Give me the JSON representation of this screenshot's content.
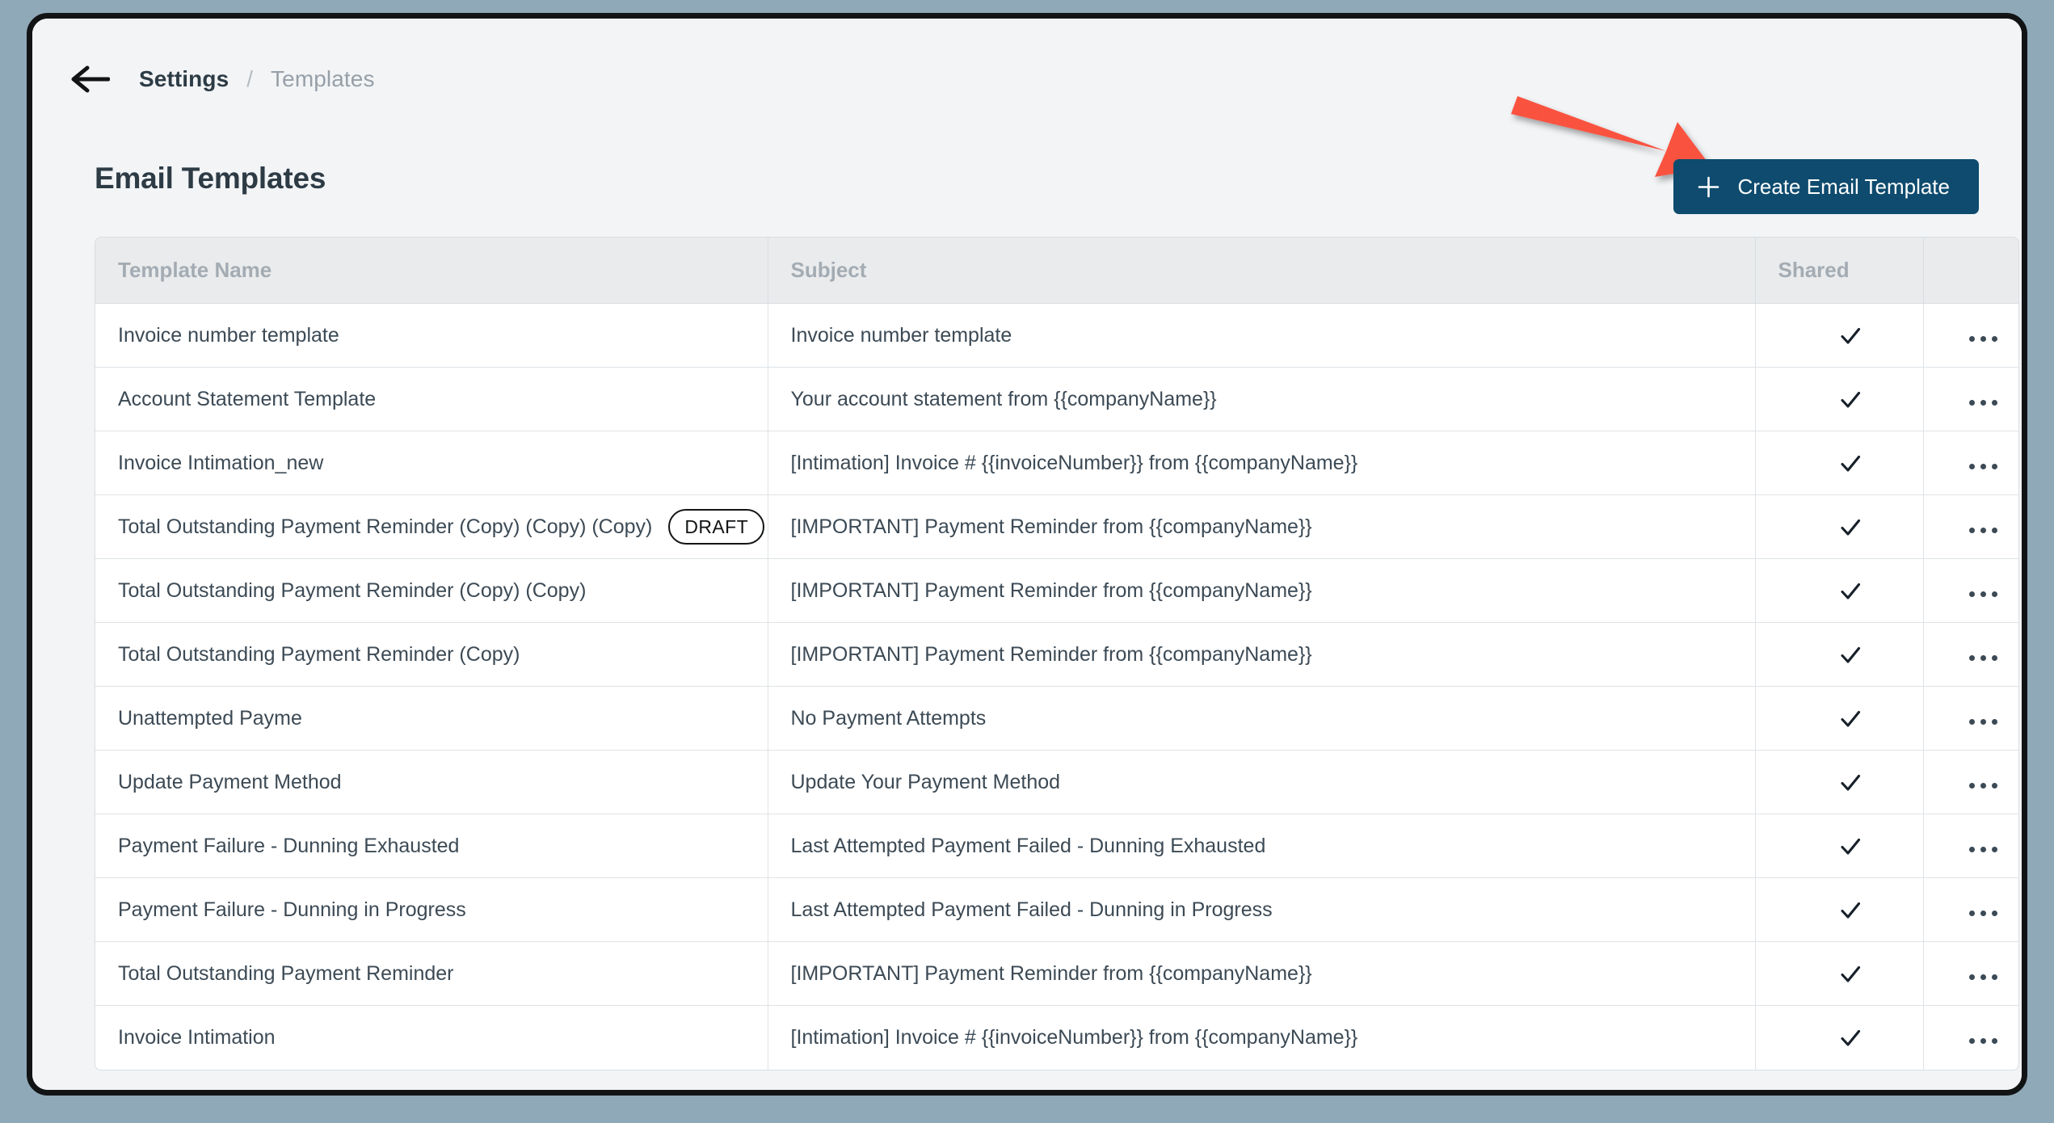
{
  "window": {
    "backdrop_color": "#8fa9b8",
    "frame_color": "#111315",
    "page_background": "#f2f4f6"
  },
  "breadcrumb": {
    "back_icon": "arrow-left-icon",
    "parent": "Settings",
    "separator": "/",
    "current": "Templates"
  },
  "header": {
    "title": "Email Templates",
    "create_button": {
      "label": "Create Email Template",
      "icon": "plus-icon",
      "background_color": "#0e4b6e",
      "text_color": "#ffffff"
    }
  },
  "annotation": {
    "type": "arrow",
    "color": "#f9523f",
    "points_to": "create-email-template-button"
  },
  "table": {
    "columns": [
      {
        "key": "name",
        "label": "Template Name"
      },
      {
        "key": "subject",
        "label": "Subject"
      },
      {
        "key": "shared",
        "label": "Shared"
      },
      {
        "key": "actions",
        "label": ""
      }
    ],
    "shared_icon": "check-icon",
    "actions_icon": "ellipsis-icon",
    "rows": [
      {
        "name": "Invoice number template",
        "badge": "",
        "subject": "Invoice number template",
        "shared": true
      },
      {
        "name": "Account Statement Template",
        "badge": "",
        "subject": "Your account statement from {{companyName}}",
        "shared": true
      },
      {
        "name": "Invoice Intimation_new",
        "badge": "",
        "subject": "[Intimation] Invoice # {{invoiceNumber}} from {{companyName}}",
        "shared": true
      },
      {
        "name": "Total Outstanding Payment Reminder (Copy) (Copy) (Copy)",
        "badge": "DRAFT",
        "subject": "[IMPORTANT] Payment Reminder from {{companyName}}",
        "shared": true
      },
      {
        "name": "Total Outstanding Payment Reminder (Copy) (Copy)",
        "badge": "",
        "subject": "[IMPORTANT] Payment Reminder from {{companyName}}",
        "shared": true
      },
      {
        "name": "Total Outstanding Payment Reminder (Copy)",
        "badge": "",
        "subject": "[IMPORTANT] Payment Reminder from {{companyName}}",
        "shared": true
      },
      {
        "name": "Unattempted Payme",
        "badge": "",
        "subject": "No Payment Attempts",
        "shared": true
      },
      {
        "name": "Update Payment Method",
        "badge": "",
        "subject": "Update Your Payment Method",
        "shared": true
      },
      {
        "name": "Payment Failure - Dunning Exhausted",
        "badge": "",
        "subject": "Last Attempted Payment Failed - Dunning Exhausted",
        "shared": true
      },
      {
        "name": "Payment Failure - Dunning in Progress",
        "badge": "",
        "subject": "Last Attempted Payment Failed - Dunning in Progress",
        "shared": true
      },
      {
        "name": "Total Outstanding Payment Reminder",
        "badge": "",
        "subject": "[IMPORTANT] Payment Reminder from {{companyName}}",
        "shared": true
      },
      {
        "name": "Invoice Intimation",
        "badge": "",
        "subject": "[Intimation] Invoice # {{invoiceNumber}} from {{companyName}}",
        "shared": true
      }
    ]
  }
}
